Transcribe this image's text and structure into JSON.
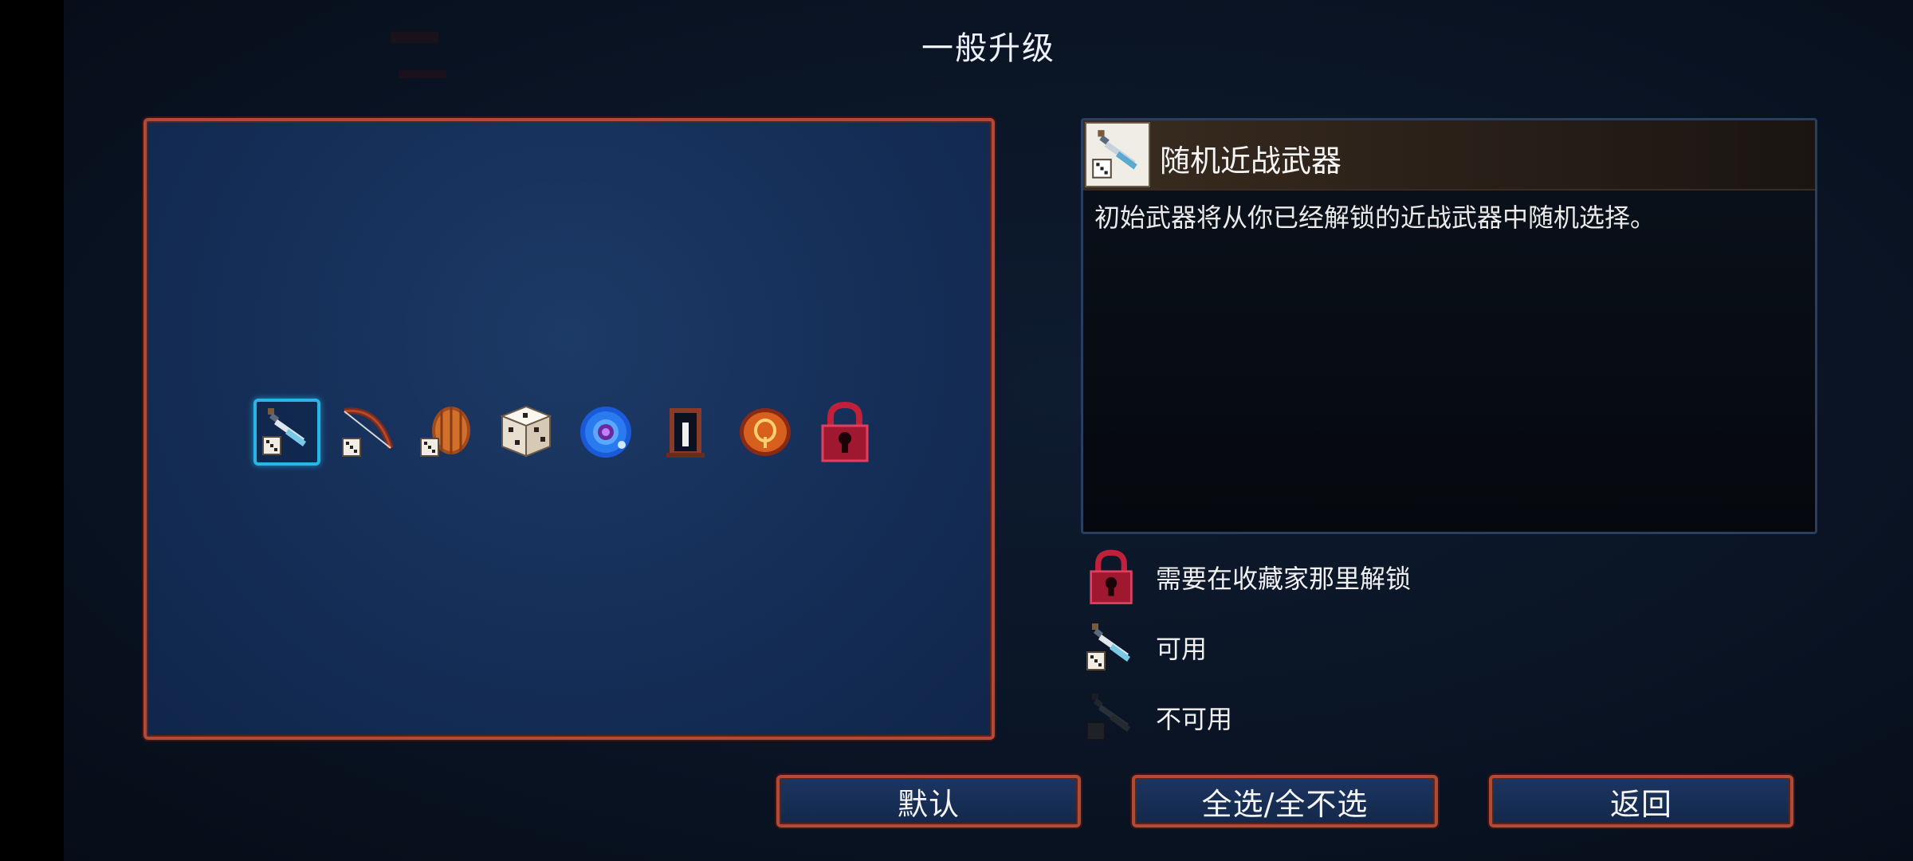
{
  "screen": {
    "title": "一般升级"
  },
  "upgrade_grid": {
    "slots": [
      {
        "icon": "random-melee-weapon-icon",
        "state": "available",
        "selected": true
      },
      {
        "icon": "random-bow-icon",
        "state": "available",
        "selected": false
      },
      {
        "icon": "random-shield-icon",
        "state": "available",
        "selected": false
      },
      {
        "icon": "dice-icon",
        "state": "available",
        "selected": false
      },
      {
        "icon": "blue-orb-icon",
        "state": "available",
        "selected": false
      },
      {
        "icon": "door-frame-icon",
        "state": "available",
        "selected": false
      },
      {
        "icon": "rune-shield-icon",
        "state": "available",
        "selected": false
      },
      {
        "icon": "red-lock-icon",
        "state": "locked",
        "selected": false
      }
    ]
  },
  "detail": {
    "name": "随机近战武器",
    "description": "初始武器将从你已经解锁的近战武器中随机选择。",
    "icon": "random-melee-weapon-icon"
  },
  "legend": [
    {
      "icon": "red-lock-icon",
      "label": "需要在收藏家那里解锁"
    },
    {
      "icon": "available-weapon-icon",
      "label": "可用"
    },
    {
      "icon": "unavailable-weapon-icon",
      "label": "不可用"
    }
  ],
  "buttons": {
    "default_label": "默认",
    "toggle_all_label": "全选/全不选",
    "back_label": "返回"
  },
  "colors": {
    "frame_accent": "#b04a3a",
    "selection": "#29b6e6",
    "panel_blue": "#16305a",
    "lock_red": "#c0203a"
  }
}
